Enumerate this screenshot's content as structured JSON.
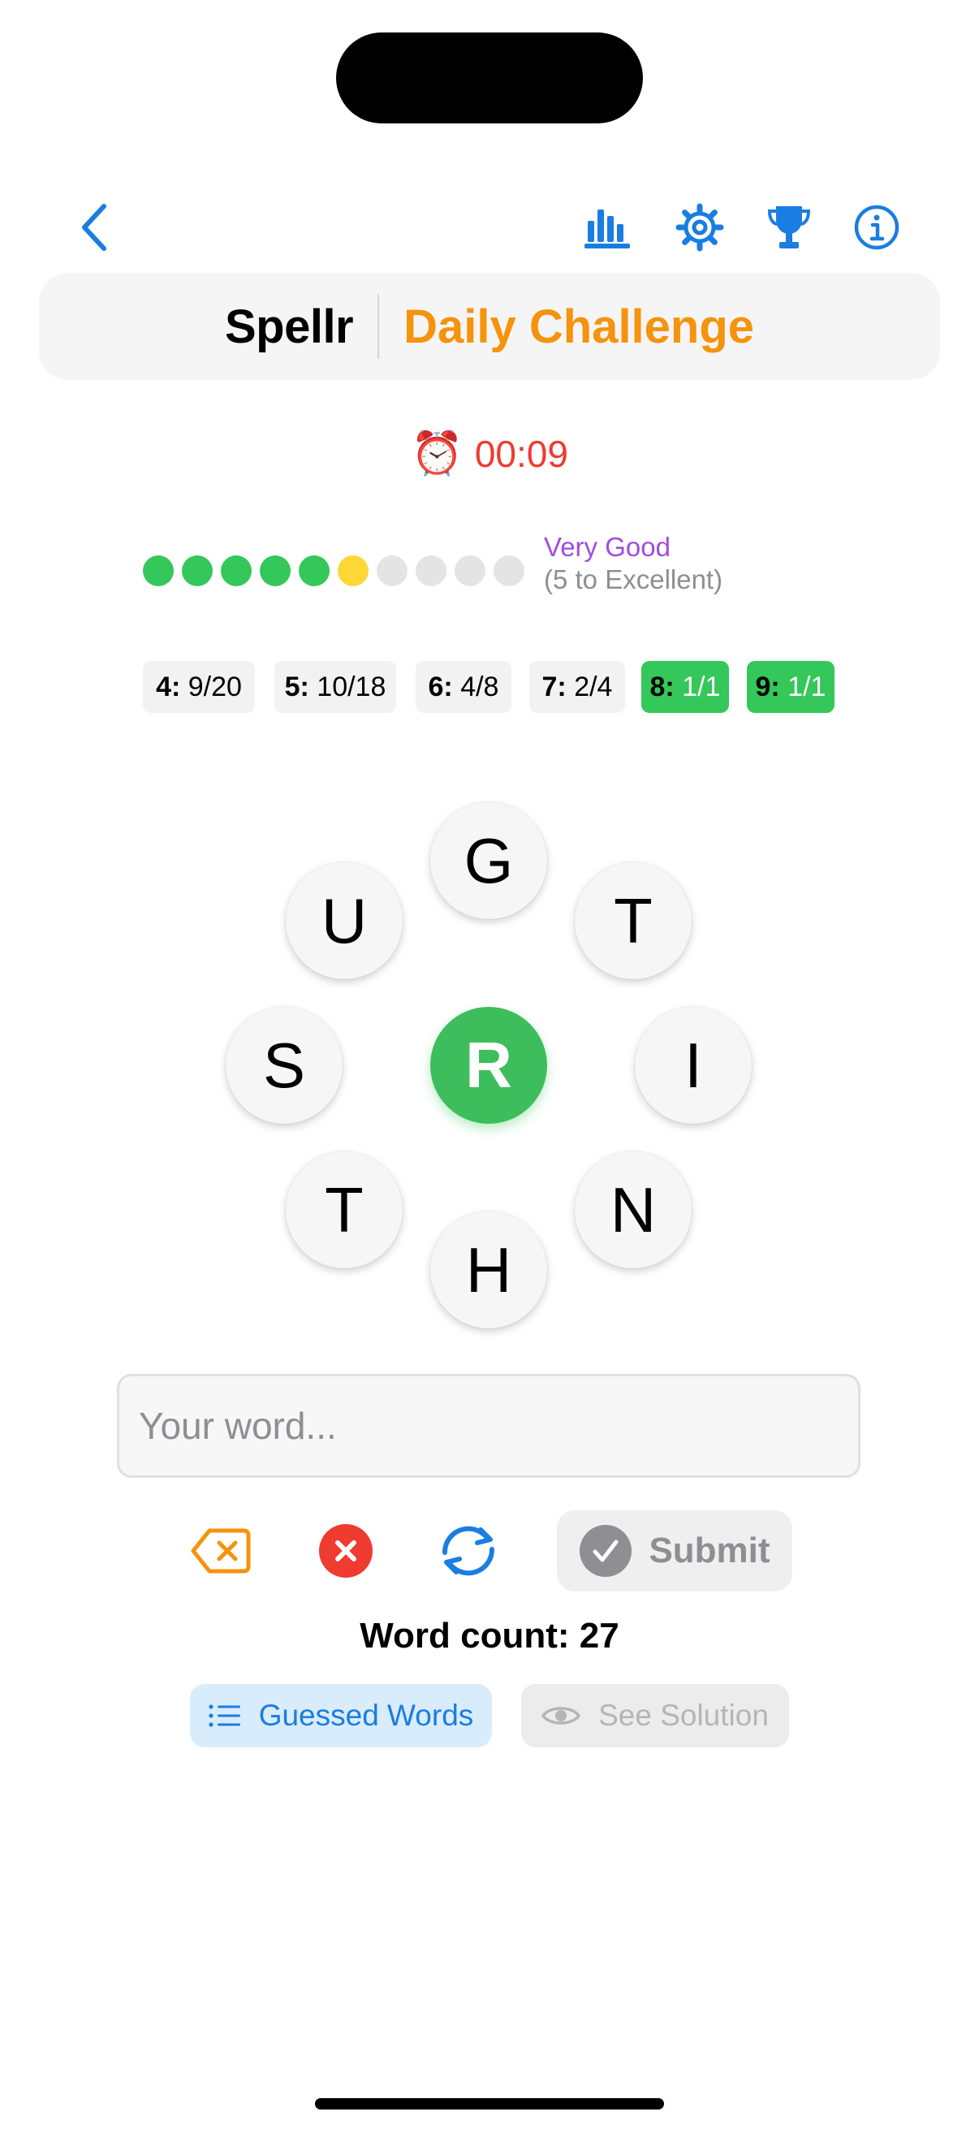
{
  "app": {
    "name": "Spellr",
    "mode": "Daily Challenge"
  },
  "toolbar": {
    "icons": [
      "chevron-left-icon",
      "bar-chart-icon",
      "gear-icon",
      "trophy-icon",
      "info-icon"
    ],
    "accent": "#1a7de2"
  },
  "timer": {
    "emoji": "⏰",
    "value": "00:09",
    "color": "#ef3b30"
  },
  "progress": {
    "filled": 5,
    "current": 1,
    "total": 10,
    "rank": "Very Good",
    "note": "(5 to Excellent)"
  },
  "length_chips": [
    {
      "len": "4:",
      "count": "9/20",
      "done": false
    },
    {
      "len": "5:",
      "count": "10/18",
      "done": false
    },
    {
      "len": "6:",
      "count": "4/8",
      "done": false
    },
    {
      "len": "7:",
      "count": "2/4",
      "done": false
    },
    {
      "len": "8:",
      "count": "1/1",
      "done": true
    },
    {
      "len": "9:",
      "count": "1/1",
      "done": true
    }
  ],
  "letters": {
    "center": "R",
    "outer": [
      "G",
      "T",
      "I",
      "N",
      "H",
      "T",
      "S",
      "U"
    ]
  },
  "input": {
    "placeholder": "Your word...",
    "value": ""
  },
  "actions": {
    "icons": [
      "backspace-icon",
      "clear-icon",
      "shuffle-icon",
      "checkmark-icon"
    ],
    "submit": "Submit"
  },
  "word_count": "Word count: 27",
  "buttons": {
    "guessed": "Guessed Words",
    "solution": "See Solution"
  },
  "colors": {
    "green": "#34c759",
    "orange": "#f5930c",
    "yellow": "#fdd835",
    "red": "#ef3b30"
  }
}
